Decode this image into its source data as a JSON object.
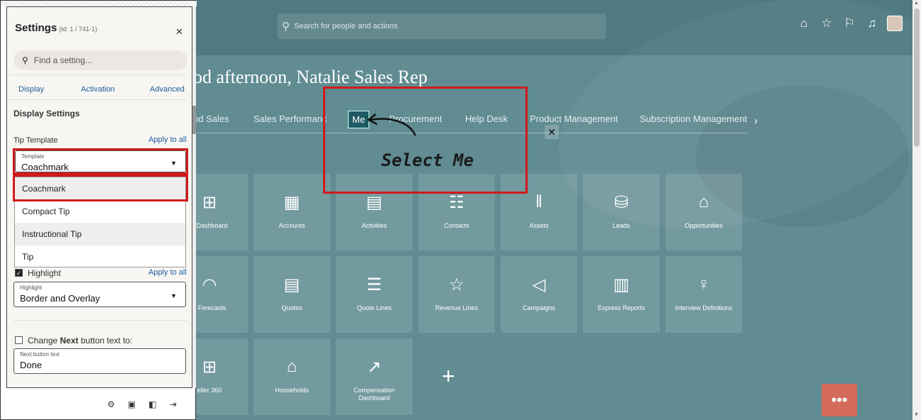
{
  "app": {
    "search_placeholder": "Search for people and actions",
    "greeting": "od afternoon, Natalie Sales Rep",
    "tabs": [
      "od Sales",
      "Sales Performanc",
      "Me",
      "Procurement",
      "Help Desk",
      "Product Management",
      "Subscription Management"
    ],
    "tiles_row1": [
      {
        "label": "s Dashboard",
        "icon": "dashboard-icon",
        "glyph": "⊞"
      },
      {
        "label": "Accounts",
        "icon": "building-icon",
        "glyph": "▦"
      },
      {
        "label": "Activities",
        "icon": "activities-icon",
        "glyph": "▤"
      },
      {
        "label": "Contacts",
        "icon": "contacts-icon",
        "glyph": "☷"
      },
      {
        "label": "Assets",
        "icon": "assets-icon",
        "glyph": "‖"
      },
      {
        "label": "Leads",
        "icon": "leads-icon",
        "glyph": "⛁"
      },
      {
        "label": "Opportunities",
        "icon": "opportunities-icon",
        "glyph": "⌂"
      }
    ],
    "tiles_row2": [
      {
        "label": "y Forecasts",
        "icon": "forecast-icon",
        "glyph": "◠"
      },
      {
        "label": "Quotes",
        "icon": "quotes-icon",
        "glyph": "▤"
      },
      {
        "label": "Quote Lines",
        "icon": "quote-lines-icon",
        "glyph": "☰"
      },
      {
        "label": "Revenue Lines",
        "icon": "revenue-lines-icon",
        "glyph": "☆"
      },
      {
        "label": "Campaigns",
        "icon": "megaphone-icon",
        "glyph": "◁"
      },
      {
        "label": "Express Reports",
        "icon": "reports-icon",
        "glyph": "▥"
      },
      {
        "label": "Interview Definitions",
        "icon": "lightbulb-icon",
        "glyph": "♀"
      }
    ],
    "tiles_row3": [
      {
        "label": "eller 360",
        "icon": "reseller-icon",
        "glyph": "⊞"
      },
      {
        "label": "Households",
        "icon": "house-icon",
        "glyph": "⌂"
      },
      {
        "label": "Compensation Dashboard",
        "icon": "compensation-icon",
        "glyph": "↗"
      }
    ],
    "coachmark_text": "Select Me"
  },
  "settings": {
    "title": "Settings",
    "id": "(id: 1 / 741-1)",
    "search_placeholder": "Find a setting...",
    "tabs": [
      "Display",
      "Activation",
      "Advanced"
    ],
    "section": "Display Settings",
    "tip_template_label": "Tip Template",
    "apply_all": "Apply to all",
    "template_field_label": "Template",
    "template_value": "Coachmark",
    "template_options": [
      "Coachmark",
      "Compact Tip",
      "Instructional Tip",
      "Tip"
    ],
    "highlight_label": "Highlight",
    "highlight_field_label": "Highlight",
    "highlight_value": "Border and Overlay",
    "change_next_prefix": "Change ",
    "change_next_bold": "Next",
    "change_next_suffix": " button text to:",
    "next_field_label": "Next button text",
    "next_value": "Done"
  },
  "colors": {
    "accent_red": "#d11a1a",
    "link_blue": "#1a5c9a",
    "teal_bg": "#608c92"
  }
}
